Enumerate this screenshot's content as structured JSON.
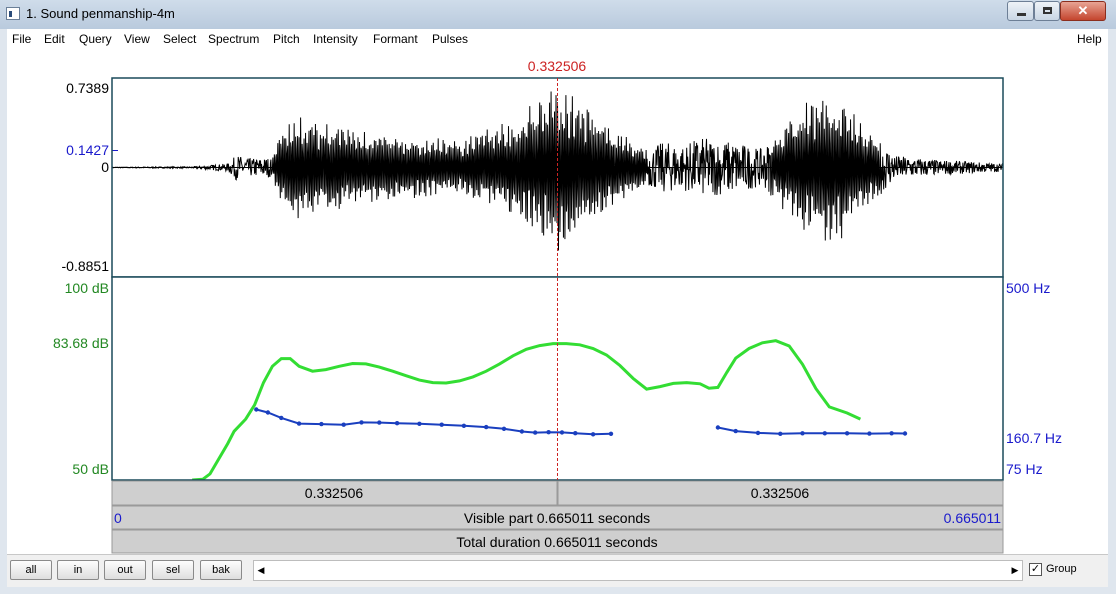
{
  "window": {
    "title": "1. Sound penmanship-4m"
  },
  "menu": {
    "items": [
      {
        "label": "File"
      },
      {
        "label": "Edit"
      },
      {
        "label": "Query"
      },
      {
        "label": "View"
      },
      {
        "label": "Select"
      },
      {
        "label": "Spectrum"
      },
      {
        "label": "Pitch"
      },
      {
        "label": "Intensity"
      },
      {
        "label": "Formant"
      },
      {
        "label": "Pulses"
      }
    ],
    "help": "Help"
  },
  "waveform": {
    "cursor_label": "0.332506",
    "max_label": "0.7389",
    "mid_label": "0.1427",
    "zero_label": "0",
    "min_label": "-0.8851",
    "color": "#000000"
  },
  "intensity": {
    "top_label": "100 dB",
    "cursor_label": "83.68 dB",
    "bottom_label": "50 dB",
    "color": "#33dd33",
    "label_color": "#228822",
    "range_db": [
      50,
      100
    ],
    "curve_db": [
      [
        0.09,
        50.0
      ],
      [
        0.102,
        50.2
      ],
      [
        0.11,
        51.5
      ],
      [
        0.122,
        56.0
      ],
      [
        0.13,
        59.0
      ],
      [
        0.137,
        62.0
      ],
      [
        0.15,
        65.0
      ],
      [
        0.16,
        68.5
      ],
      [
        0.17,
        74.0
      ],
      [
        0.18,
        78.0
      ],
      [
        0.19,
        79.9
      ],
      [
        0.2,
        79.9
      ],
      [
        0.21,
        78.0
      ],
      [
        0.225,
        76.8
      ],
      [
        0.24,
        77.2
      ],
      [
        0.255,
        78.0
      ],
      [
        0.27,
        78.7
      ],
      [
        0.285,
        78.6
      ],
      [
        0.3,
        77.8
      ],
      [
        0.315,
        76.8
      ],
      [
        0.33,
        75.7
      ],
      [
        0.345,
        74.6
      ],
      [
        0.36,
        74.0
      ],
      [
        0.375,
        73.9
      ],
      [
        0.39,
        74.4
      ],
      [
        0.405,
        75.4
      ],
      [
        0.42,
        76.8
      ],
      [
        0.435,
        78.6
      ],
      [
        0.45,
        80.6
      ],
      [
        0.465,
        82.2
      ],
      [
        0.48,
        83.1
      ],
      [
        0.495,
        83.6
      ],
      [
        0.51,
        83.6
      ],
      [
        0.525,
        83.3
      ],
      [
        0.54,
        82.4
      ],
      [
        0.555,
        80.8
      ],
      [
        0.57,
        78.2
      ],
      [
        0.585,
        75.0
      ],
      [
        0.6,
        72.4
      ],
      [
        0.615,
        73.0
      ],
      [
        0.63,
        73.8
      ],
      [
        0.645,
        74.0
      ],
      [
        0.66,
        73.7
      ],
      [
        0.67,
        72.6
      ],
      [
        0.68,
        72.8
      ],
      [
        0.69,
        76.5
      ],
      [
        0.7,
        80.0
      ],
      [
        0.715,
        82.4
      ],
      [
        0.73,
        83.8
      ],
      [
        0.745,
        84.3
      ],
      [
        0.76,
        83.0
      ],
      [
        0.775,
        78.5
      ],
      [
        0.79,
        72.5
      ],
      [
        0.805,
        68.0
      ],
      [
        0.825,
        66.5
      ],
      [
        0.84,
        65.0
      ]
    ]
  },
  "pitch": {
    "top_label": "500 Hz",
    "mid_label": "160.7 Hz",
    "bottom_label": "75 Hz",
    "color": "#1a3fbf",
    "label_color": "#1a1acc",
    "range_hz": [
      75,
      500
    ],
    "segments": [
      [
        [
          0.162,
          145.0
        ],
        [
          0.175,
          141.0
        ],
        [
          0.19,
          134.0
        ],
        [
          0.21,
          127.0
        ],
        [
          0.235,
          126.5
        ],
        [
          0.26,
          125.8
        ],
        [
          0.28,
          128.5
        ],
        [
          0.3,
          128.2
        ],
        [
          0.32,
          127.5
        ],
        [
          0.345,
          126.8
        ],
        [
          0.37,
          125.8
        ],
        [
          0.395,
          124.5
        ],
        [
          0.42,
          123.0
        ],
        [
          0.44,
          121.0
        ],
        [
          0.46,
          118.0
        ],
        [
          0.475,
          116.8
        ],
        [
          0.49,
          117.2
        ],
        [
          0.505,
          117.0
        ],
        [
          0.52,
          116.2
        ],
        [
          0.54,
          115.0
        ],
        [
          0.56,
          115.5
        ]
      ],
      [
        [
          0.68,
          122.5
        ],
        [
          0.7,
          118.5
        ],
        [
          0.725,
          116.5
        ],
        [
          0.75,
          115.5
        ],
        [
          0.775,
          116.0
        ],
        [
          0.8,
          116.0
        ],
        [
          0.825,
          116.0
        ],
        [
          0.85,
          115.7
        ],
        [
          0.875,
          116.0
        ],
        [
          0.89,
          115.8
        ]
      ]
    ]
  },
  "time": {
    "left_segment": "0.332506",
    "right_segment": "0.332506",
    "visible_start": "0",
    "visible_part": "Visible part 0.665011 seconds",
    "visible_end": "0.665011",
    "total": "Total duration 0.665011 seconds"
  },
  "toolbar": {
    "buttons": [
      {
        "label": "all"
      },
      {
        "label": "in"
      },
      {
        "label": "out"
      },
      {
        "label": "sel"
      },
      {
        "label": "bak"
      }
    ],
    "group_checked": "✓",
    "group_label": "Group"
  },
  "cursor_color": "#cc2222",
  "frame_color": "#1a4a5a"
}
